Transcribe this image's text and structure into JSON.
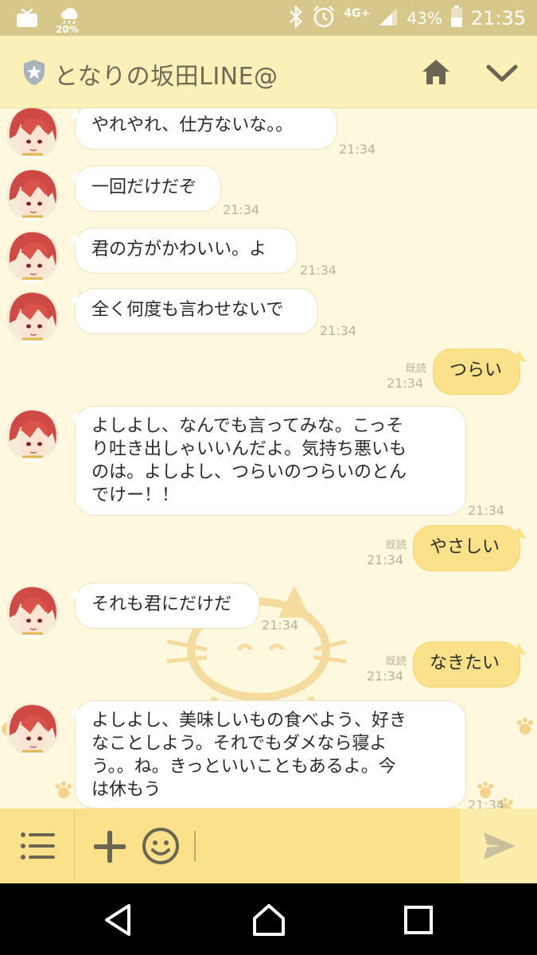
{
  "status_bar": {
    "weather_percent": "20%",
    "network": "4G+",
    "battery": "43%",
    "time": "21:35"
  },
  "header": {
    "title": "となりの坂田LINE@"
  },
  "messages": [
    {
      "side": "in",
      "text": "やれやれ、仕方ないな。。",
      "time": "21:34"
    },
    {
      "side": "in",
      "text": "一回だけだぞ",
      "time": "21:34"
    },
    {
      "side": "in",
      "text": "君の方がかわいい。よ",
      "time": "21:34"
    },
    {
      "side": "in",
      "text": "全く何度も言わせないで",
      "time": "21:34"
    },
    {
      "side": "out",
      "text": "つらい",
      "read": "既読",
      "time": "21:34"
    },
    {
      "side": "in",
      "lines": [
        "よしよし、なんでも言ってみな。こっそ",
        "り吐き出しゃいいんだよ。気持ち悪いも",
        "のは。よしよし、つらいのつらいのとん",
        "でけー！！"
      ],
      "time": "21:34"
    },
    {
      "side": "out",
      "text": "やさしい",
      "read": "既読",
      "time": "21:34"
    },
    {
      "side": "in",
      "text": "それも君にだけだ",
      "time": "21:34"
    },
    {
      "side": "out",
      "text": "なきたい",
      "read": "既読",
      "time": "21:34"
    },
    {
      "side": "in",
      "lines": [
        "よしよし、美味しいもの食べよう、好き",
        "なことしよう。それでもダメなら寝よ",
        "う。。ね。きっといいこともあるよ。今",
        "は休もう"
      ],
      "time": "21:34"
    }
  ],
  "colors": {
    "status_bar": "#d8c78a",
    "header": "#fbf0b8",
    "chat_bg": "#fdf8de",
    "out_bubble": "#fbe28a",
    "in_bubble": "#ffffff",
    "input_bar": "#fbe28a"
  },
  "icons": {
    "header": [
      "shield-star-icon",
      "home-icon",
      "chevron-down-icon"
    ],
    "input": [
      "menu-icon",
      "plus-icon",
      "emoji-icon",
      "send-icon"
    ],
    "nav": [
      "back-icon",
      "home-nav-icon",
      "recents-icon"
    ]
  }
}
